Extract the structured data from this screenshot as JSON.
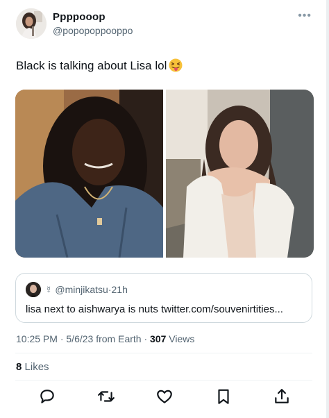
{
  "author": {
    "name": "Ppppooop",
    "handle": "@popopoppooppo"
  },
  "tweet": {
    "text": "Black is talking about Lisa lol",
    "emoji": "squinting-face-with-tongue"
  },
  "quoted": {
    "symbol": "☿",
    "handle": "@minjikatsu",
    "separator": "·",
    "time": "21h",
    "text": "lisa next to aishwarya is nuts twitter.com/souvenirtities..."
  },
  "meta": {
    "time": "10:25 PM",
    "date": "5/6/23",
    "source": "from Earth",
    "views_count": "307",
    "views_label": "Views"
  },
  "stats": {
    "likes_count": "8",
    "likes_label": "Likes"
  },
  "icons": [
    "reply-icon",
    "retweet-icon",
    "like-icon",
    "bookmark-icon",
    "share-icon",
    "more-icon"
  ],
  "colors": {
    "text": "#0f1419",
    "secondary": "#536471",
    "border": "#cfd9de"
  }
}
